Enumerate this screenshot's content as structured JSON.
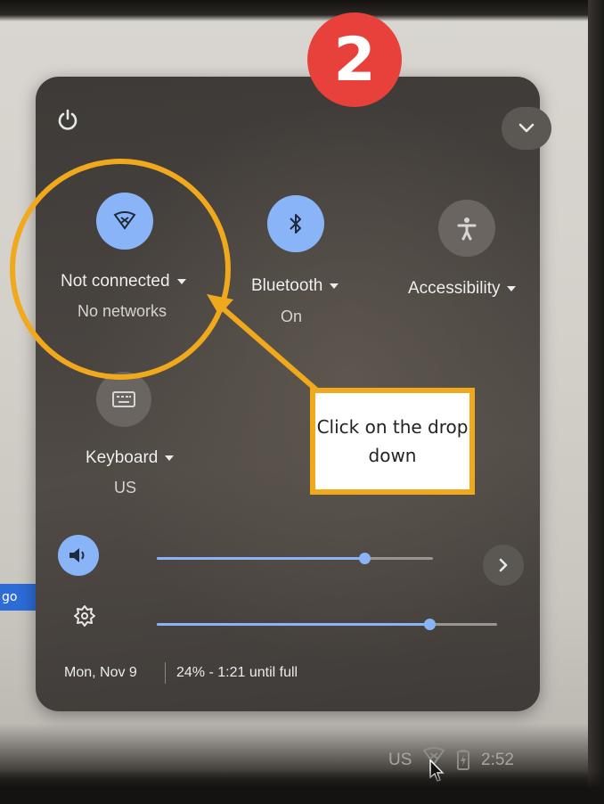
{
  "step_number": "2",
  "quick_settings": {
    "network": {
      "label": "Not connected",
      "sub": "No networks",
      "icon": "wifi-off-icon"
    },
    "bluetooth": {
      "label": "Bluetooth",
      "sub": "On",
      "icon": "bluetooth-icon"
    },
    "accessibility": {
      "label": "Accessibility",
      "icon": "accessibility-icon"
    },
    "keyboard": {
      "label": "Keyboard",
      "sub": "US",
      "icon": "keyboard-icon"
    },
    "volume": {
      "level": 0.75,
      "icon": "volume-icon"
    },
    "brightness": {
      "level": 0.8,
      "icon": "brightness-icon"
    },
    "date": "Mon, Nov 9",
    "battery_status": "24% - 1:21 until full"
  },
  "shelf": {
    "input_method": "US",
    "time": "2:52"
  },
  "left_partial_text": "go",
  "annotation": {
    "callout_text": "Click on the drop down"
  },
  "colors": {
    "accent_blue": "#8ab4f8",
    "annotation_orange": "#f0a81d",
    "badge_red": "#e8403a",
    "panel_dark": "#45413d"
  }
}
